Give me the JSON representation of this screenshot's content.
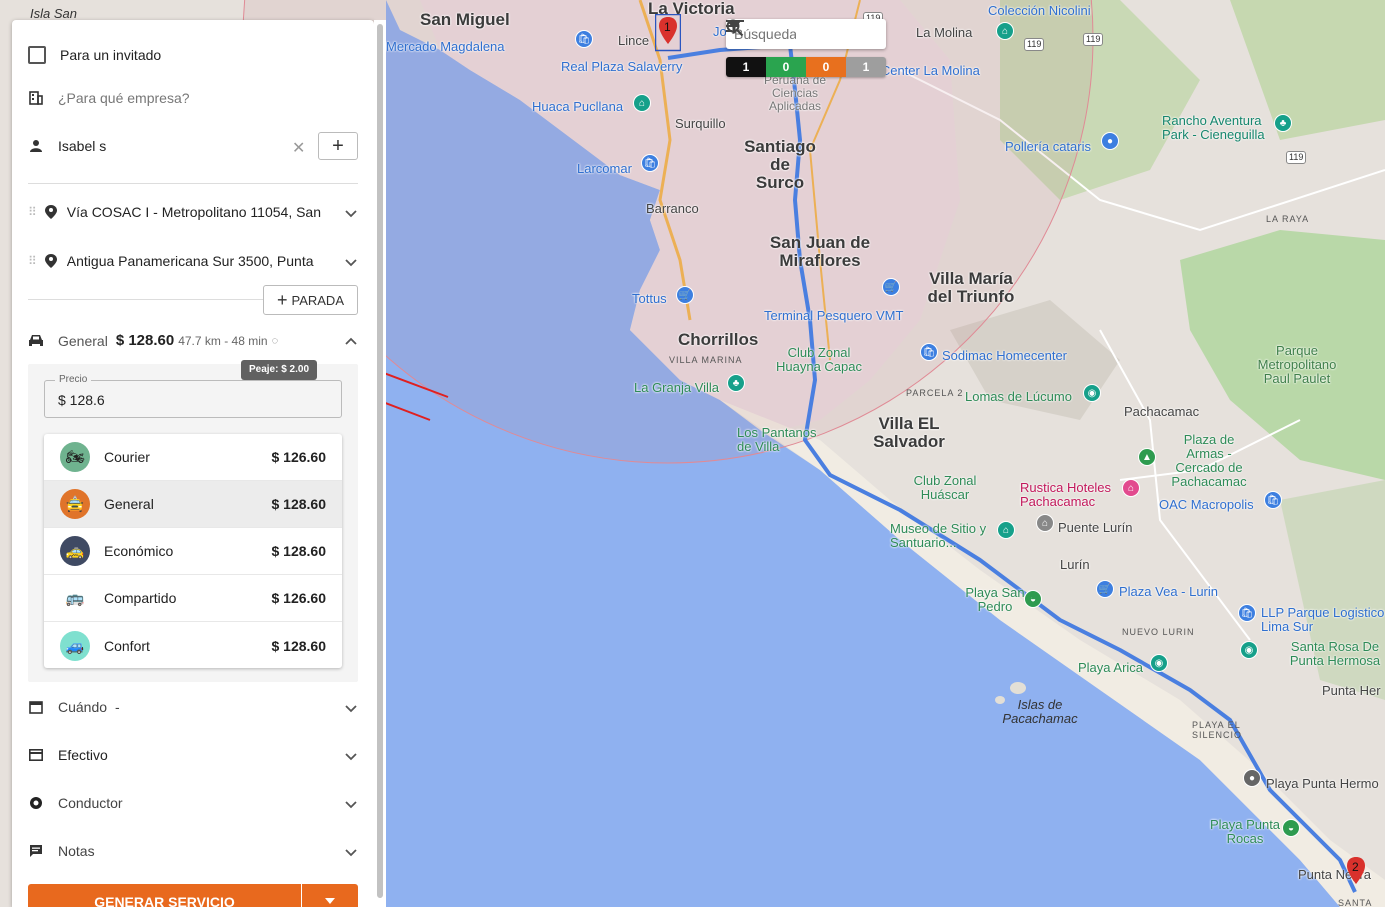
{
  "map": {
    "labels": {
      "isla_san": "Isla San",
      "san_miguel": "San Miguel",
      "la_victoria": "La Victoria",
      "coleccion": "Colección Nicolini",
      "mercado": "Mercado Magdalena",
      "lince": "Lince",
      "jo": "Jo",
      "la_molina": "La Molina",
      "real_plaza": "Real Plaza Salaverry",
      "center_molina": "a Center La Molina",
      "huaca": "Huaca Pucllana",
      "peruana": "Peruana de Ciencias Aplicadas",
      "surquillo": "Surquillo",
      "rancho": "Rancho Aventura Park - Cieneguilla",
      "larcomar": "Larcomar",
      "santiago": "Santiago de Surco",
      "polleria": "Pollería cataris",
      "barranco": "Barranco",
      "san_juan": "San Juan de Miraflores",
      "la_raya": "LA RAYA",
      "villa_maria": "Villa María del Triunfo",
      "tottus": "Tottus",
      "terminal": "Terminal Pesquero VMT",
      "chorrillos": "Chorrillos",
      "villa_marina": "VILLA MARINA",
      "club_huayna": "Club Zonal Huayna Capac",
      "sodimac": "Sodimac Homecenter",
      "parque_met": "Parque Metropolitano Paul Paulet",
      "granja": "La Granja Villa",
      "parcela": "PARCELA 2",
      "lomas": "Lomas de Lúcumo",
      "villa_salvador": "Villa EL Salvador",
      "pachacamac": "Pachacamac",
      "pantanos": "Los Pantanos de Villa",
      "plaza_armas": "Plaza de Armas - Cercado de Pachacamac",
      "club_huascar": "Club Zonal Huáscar",
      "rustica": "Rustica Hoteles Pachacamac",
      "oac": "OAC Macropolis",
      "museo": "Museo de Sitio y Santuario...",
      "puente_lurin": "Puente Lurín",
      "lurin": "Lurín",
      "playa_san_pedro": "Playa San Pedro",
      "plaza_vea": "Plaza Vea - Lurin",
      "llp": "LLP Parque Logistico Lima Sur",
      "nuevo_lurin": "NUEVO LURIN",
      "santa_rosa": "Santa Rosa De Punta Hermosa",
      "playa_arica": "Playa Arica",
      "punta_her": "Punta Her",
      "islas": "Islas de Pacachamac",
      "playa_silencio": "PLAYA EL SILENCIO",
      "playa_punta_hermosa": "Playa Punta Hermo",
      "playa_punta_rocas": "Playa Punta Rocas",
      "punta_negra": "Punta Negra",
      "santa": "SANTA",
      "r119a": "119",
      "r119b": "119",
      "r119c": "119",
      "r119d": "119"
    },
    "pin_start": "1",
    "pin_end": "2",
    "route_color": "#4a7fe0"
  },
  "map_toolbar": {
    "search_placeholder": "Búsqueda",
    "counters": [
      {
        "value": "1",
        "color": "#111111"
      },
      {
        "value": "0",
        "color": "#2aa44f"
      },
      {
        "value": "0",
        "color": "#e8701e"
      },
      {
        "value": "1",
        "color": "#9e9e9e"
      }
    ]
  },
  "panel": {
    "guest_label": "Para un invitado",
    "company_placeholder": "¿Para qué empresa?",
    "passenger": "Isabel s",
    "origin": "Vía COSAC I - Metropolitano 11054, San",
    "destination": "Antigua Panamericana Sur 3500, Punta",
    "add_stop": "PARADA",
    "summary": {
      "category": "General",
      "price": "$ 128.60",
      "distance_time": "47.7 km - 48 min"
    },
    "toll_tooltip": "Peaje: $ 2.00",
    "price_label": "Precio",
    "price_value": "$ 128.6",
    "vehicles": [
      {
        "name": "Courier",
        "price": "$ 126.60",
        "icon_color": "#6fb38f",
        "glyph": "🏍"
      },
      {
        "name": "General",
        "price": "$ 128.60",
        "icon_color": "#e0742a",
        "glyph": "🚖"
      },
      {
        "name": "Económico",
        "price": "$ 128.60",
        "icon_color": "#3f4a63",
        "glyph": "🚕"
      },
      {
        "name": "Compartido",
        "price": "$ 126.60",
        "icon_color": "#ffffff",
        "glyph": "🚌"
      },
      {
        "name": "Confort",
        "price": "$ 128.60",
        "icon_color": "#7fe0cf",
        "glyph": "🚙"
      }
    ],
    "when_label": "Cuándo",
    "when_value": "-",
    "payment": "Efectivo",
    "driver": "Conductor",
    "notes": "Notas",
    "generate_button": "GENERAR SERVICIO"
  }
}
